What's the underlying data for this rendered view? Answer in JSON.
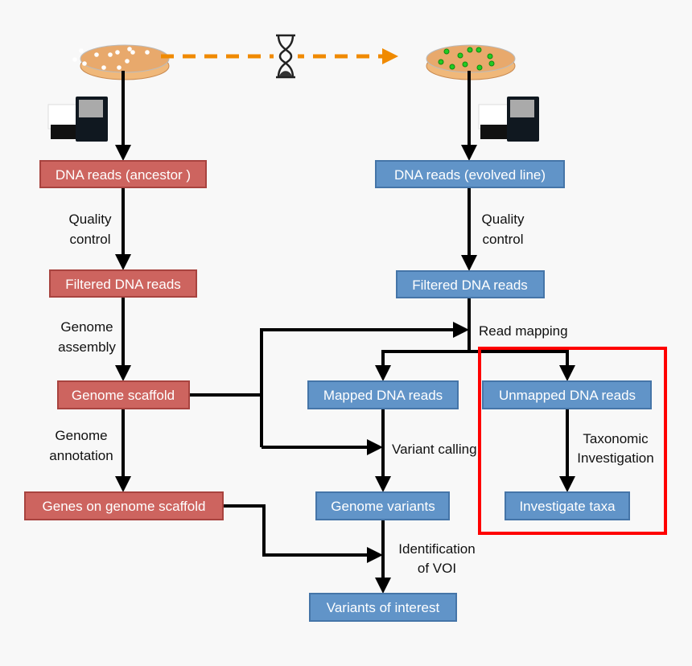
{
  "colors": {
    "ancestor_box": "#cd645f",
    "evolved_box": "#6194c8",
    "highlight": "#ff0000",
    "time_arrow": "#f08a00",
    "plate": "#e8a96c"
  },
  "icons": {
    "plate_left": "petri-dish-white-colonies",
    "plate_right": "petri-dish-green-colonies",
    "hourglass": "hourglass-icon",
    "sequencer": "dna-sequencer-icon"
  },
  "boxes": {
    "dna_ancestor": "DNA reads (ancestor )",
    "dna_evolved": "DNA reads (evolved  line)",
    "filtered_left": "Filtered DNA reads",
    "filtered_right": "Filtered DNA reads",
    "genome_scaffold": "Genome scaffold",
    "mapped": "Mapped DNA reads",
    "unmapped": "Unmapped DNA reads",
    "genes": "Genes on genome scaffold",
    "variants": "Genome variants",
    "taxa": "Investigate taxa",
    "voi": "Variants of interest"
  },
  "labels": {
    "qc_left": [
      "Quality",
      "control"
    ],
    "assembly": [
      "Genome",
      "assembly"
    ],
    "annotation": [
      "Genome",
      "annotation"
    ],
    "qc_right": [
      "Quality",
      "control"
    ],
    "read_mapping": "Read mapping",
    "variant_calling": "Variant calling",
    "taxonomic": [
      "Taxonomic",
      "Investigation"
    ],
    "identification": [
      "Identification",
      "of VOI"
    ]
  }
}
